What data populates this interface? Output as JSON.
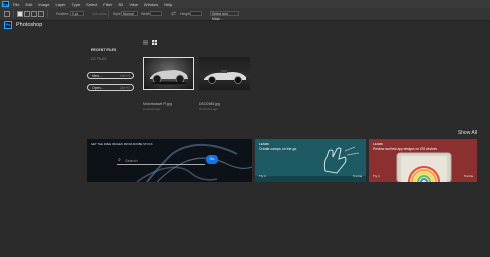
{
  "menubar": {
    "logo": "Ps",
    "items": [
      "File",
      "Edit",
      "Image",
      "Layer",
      "Type",
      "Select",
      "Filter",
      "3D",
      "View",
      "Window",
      "Help"
    ]
  },
  "options": {
    "feather_label": "Feather:",
    "feather_value": "0 px",
    "antialias_label": "Anti-alias",
    "style_label": "Style:",
    "style_value": "Normal",
    "width_label": "Width:",
    "height_label": "Height:",
    "refine_label": "Select and Mask..."
  },
  "home": {
    "logo": "Ps",
    "title": "Photoshop"
  },
  "left_panel": {
    "recent_header": "RECENT FILES",
    "cc_files": "CC FILES",
    "new_label": "New...",
    "new_shortcut": "Ctrl+N",
    "open_label": "Open...",
    "open_shortcut": "Ctrl+O"
  },
  "recent_files": [
    {
      "name": "Motorbasket Pl.jpg",
      "time": "a minute ago"
    },
    {
      "name": "DSC0985.jpg",
      "time": "3 minutes ago"
    }
  ],
  "show_all": "Show All",
  "cards": [
    {
      "heading": "GET THE FREE IMAGES FROM ADOBE STOCK",
      "search_placeholder": "Search",
      "go_label": "Go"
    },
    {
      "learn": "LEARN",
      "title": "Create comps on the go",
      "try": "Try it",
      "mins": "5 mins"
    },
    {
      "learn": "LEARN",
      "title": "Preview and test app designs on iOS devices",
      "try": "Try it",
      "mins": "5 mins"
    }
  ],
  "colors": {
    "ps_blue": "#31a8ff",
    "card2_bg": "#1d5a64",
    "card3_bg": "#8c2f2f",
    "go_button": "#1473e6"
  }
}
